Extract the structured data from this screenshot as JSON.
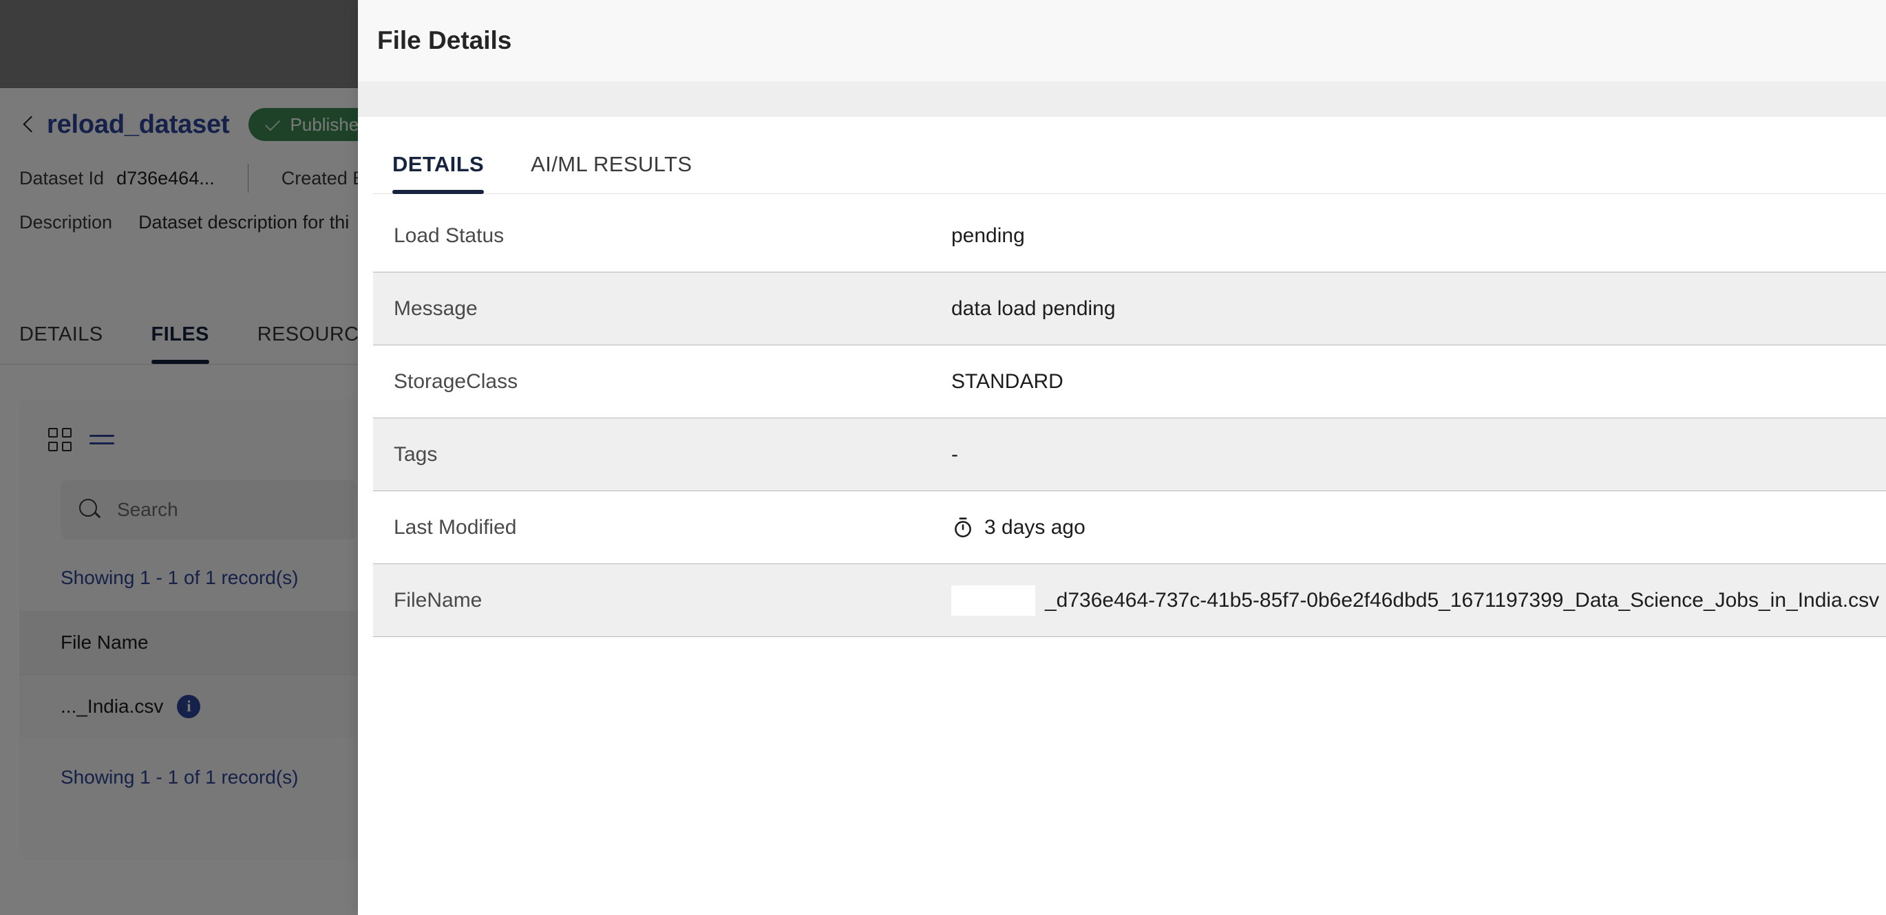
{
  "background": {
    "dataset": {
      "back_label": "back",
      "title": "reload_dataset",
      "status_badge": "Published",
      "id_label": "Dataset Id",
      "id_value": "d736e464...",
      "created_label": "Created B",
      "description_label": "Description",
      "description_value": "Dataset description for thi"
    },
    "tabs": [
      {
        "label": "DETAILS",
        "active": false
      },
      {
        "label": "FILES",
        "active": true
      },
      {
        "label": "RESOURCE",
        "active": false
      }
    ],
    "files_panel": {
      "view_grid_icon": "grid-view-icon",
      "view_list_icon": "list-view-icon",
      "search_placeholder": "Search",
      "search_value": "",
      "refresh_icon": "refresh-icon",
      "showing_top": "Showing 1 - 1 of 1 record(s)",
      "showing_bottom": "Showing 1 - 1 of 1 record(s)",
      "columns": [
        "File Name"
      ],
      "rows": [
        {
          "file_name": "..._India.csv",
          "info_icon": "info-icon"
        }
      ]
    }
  },
  "modal": {
    "title": "File Details",
    "tabs": [
      {
        "label": "DETAILS",
        "active": true
      },
      {
        "label": "AI/ML RESULTS",
        "active": false
      }
    ],
    "details": [
      {
        "label": "Load Status",
        "value": "pending"
      },
      {
        "label": "Message",
        "value": "data load pending"
      },
      {
        "label": "StorageClass",
        "value": "STANDARD"
      },
      {
        "label": "Tags",
        "value": "-"
      },
      {
        "label": "Last Modified",
        "value": "3 days ago",
        "icon": "timer-icon"
      },
      {
        "label": "FileName",
        "value": "_d736e464-737c-41b5-85f7-0b6e2f46dbd5_1671197399_Data_Science_Jobs_in_India.csv",
        "redacted_prefix": true
      }
    ]
  },
  "colors": {
    "accent_blue": "#2c4596",
    "tab_active": "#16243f",
    "published_green": "#3d8a54",
    "row_alt": "#efefef",
    "dim_overlay": "rgba(0,0,0,0.52)"
  }
}
